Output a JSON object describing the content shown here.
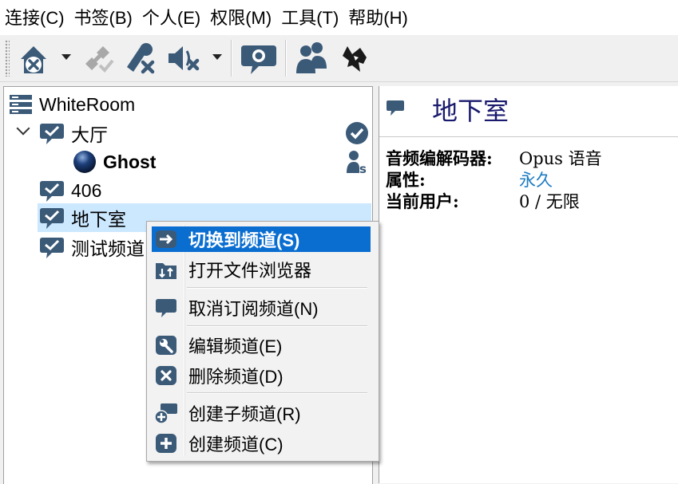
{
  "menu": [
    {
      "label": "连接(C)"
    },
    {
      "label": "书签(B)"
    },
    {
      "label": "个人(E)"
    },
    {
      "label": "权限(M)"
    },
    {
      "label": "工具(T)"
    },
    {
      "label": "帮助(H)"
    }
  ],
  "toolbar": {
    "icons": [
      "disconnect-icon",
      "connect-icon",
      "mute-microphone-icon",
      "mute-speaker-icon",
      "chat-bubble-icon",
      "contacts-icon",
      "wolf-logo-icon"
    ]
  },
  "tree": {
    "server": "WhiteRoom",
    "channels": [
      {
        "name": "大厅",
        "expanded": true,
        "status_icon": "check-circle-icon"
      },
      {
        "name": "406"
      },
      {
        "name": "地下室",
        "selected": true
      },
      {
        "name": "测试频道"
      }
    ],
    "client": {
      "name": "Ghost",
      "status_icon": "server-admin-icon"
    }
  },
  "info": {
    "channel_title": "地下室",
    "codec_label": "音频编解码器:",
    "codec_value": "Opus 语音",
    "attr_label": "属性:",
    "attr_value": "永久",
    "users_label": "当前用户:",
    "users_value": "0 / 无限",
    "link_color": "#1e7bc2"
  },
  "context_menu": [
    {
      "label": "切换到频道(S)",
      "icon": "arrow-right-icon",
      "highlighted": true
    },
    {
      "label": "打开文件浏览器",
      "icon": "folder-transfer-icon"
    },
    {
      "label": "取消订阅频道(N)",
      "icon": "chat-bubble-icon"
    },
    {
      "label": "编辑频道(E)",
      "icon": "wrench-icon"
    },
    {
      "label": "删除频道(D)",
      "icon": "delete-icon"
    },
    {
      "label": "创建子频道(R)",
      "icon": "add-subchannel-icon"
    },
    {
      "label": "创建频道(C)",
      "icon": "add-icon"
    }
  ],
  "colors": {
    "accent": "#0a6ed1",
    "selection": "#cce8ff",
    "icon": "#3b5a78"
  }
}
